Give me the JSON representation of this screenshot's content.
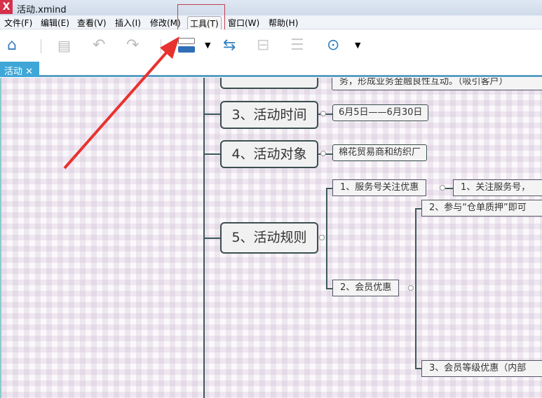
{
  "window": {
    "title": "活动.xmind",
    "logo": "X"
  },
  "menu": [
    "文件(F)",
    "编辑(E)",
    "查看(V)",
    "插入(I)",
    "修改(M)",
    "工具(T)",
    "窗口(W)",
    "帮助(H)"
  ],
  "toolbar": {
    "icons": [
      "home-icon",
      "save-icon",
      "undo-icon",
      "redo-icon",
      "topic-style-icon",
      "relationship-icon",
      "structure-icon",
      "boundary-icon",
      "more-icon"
    ]
  },
  "tab": {
    "label": "活动",
    "close": "✕"
  },
  "map": {
    "partial_top": "务，形成业务金融良性互动。（吸引客户）",
    "topics": [
      {
        "label": "3、活动时间",
        "child": "6月5日——6月30日"
      },
      {
        "label": "4、活动对象",
        "child": "棉花贸易商和纺织厂"
      },
      {
        "label": "5、活动规则"
      }
    ],
    "rules": [
      {
        "label": "1、服务号关注优惠",
        "child": "1、关注服务号，"
      },
      {
        "label": "2、会员优惠",
        "children": [
          "2、参与“仓单质押”即可",
          "3、会员等级优惠（内部"
        ]
      }
    ]
  },
  "colors": {
    "accent": "#3fa7d8",
    "annotation": "#e8322f"
  }
}
